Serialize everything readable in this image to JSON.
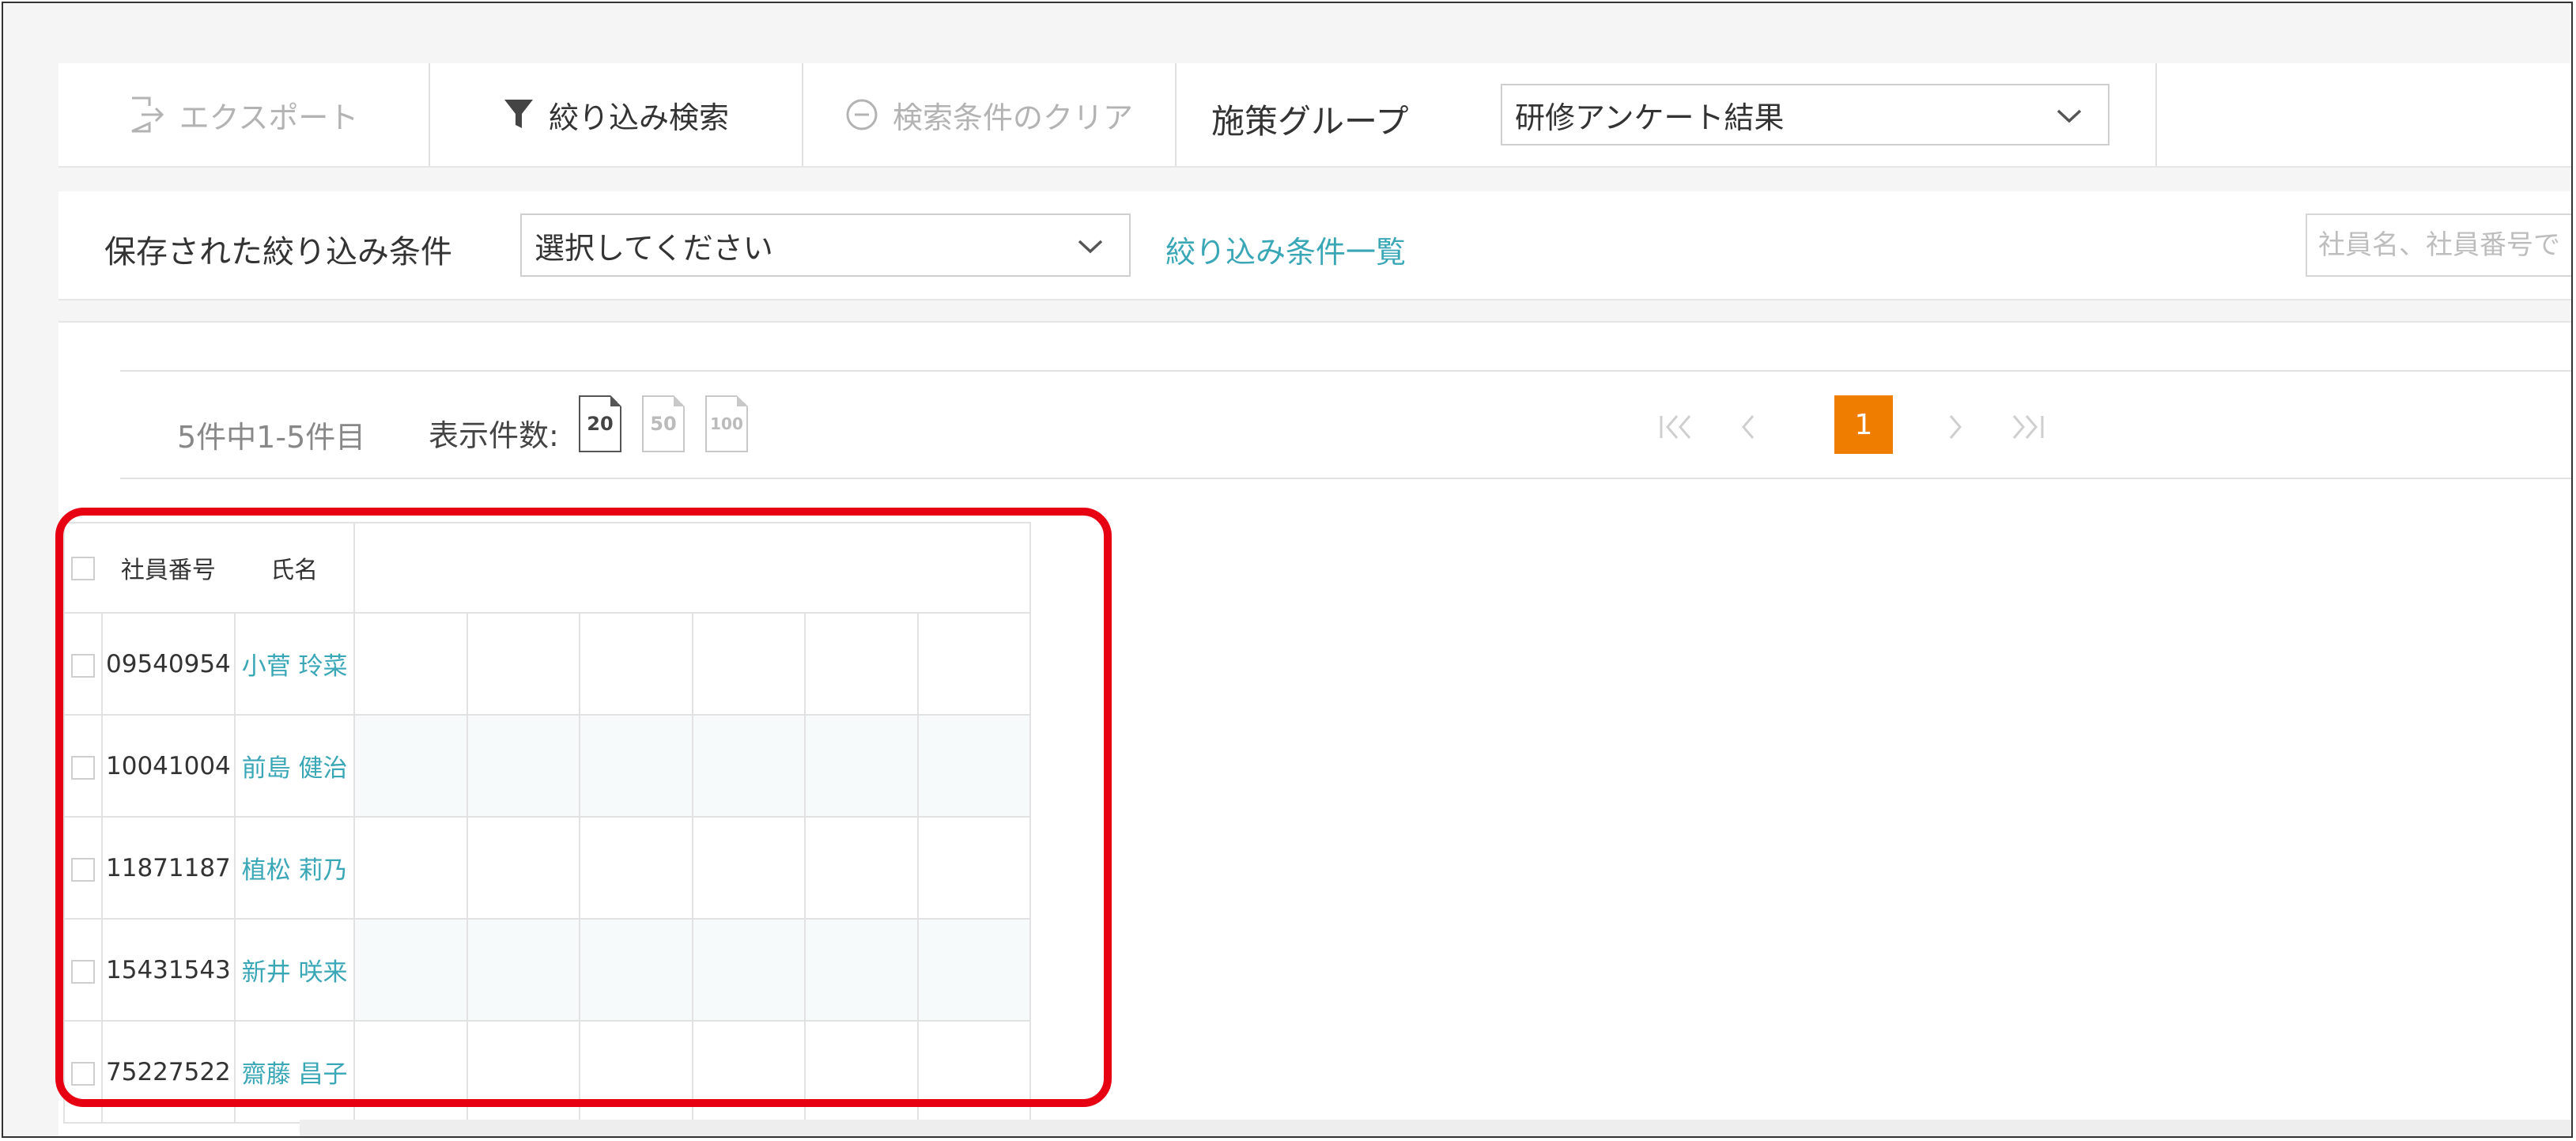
{
  "toolbar": {
    "export_label": "エクスポート",
    "filter_label": "絞り込み検索",
    "clear_label": "検索条件のクリア",
    "group_label": "施策グループ",
    "group_value": "研修アンケート結果"
  },
  "saved_filter": {
    "label": "保存された絞り込み条件",
    "select_value": "選択してください",
    "list_link": "絞り込み条件一覧",
    "search_placeholder": "社員名、社員番号で"
  },
  "pager": {
    "count_text": "5件中1-5件目",
    "per_page_label": "表示件数:",
    "sizes": [
      "20",
      "50",
      "100"
    ],
    "active_size": "20",
    "current_page": "1"
  },
  "table": {
    "headers": {
      "id": "社員番号",
      "name": "氏名"
    },
    "rows": [
      {
        "id": "09540954",
        "name": "小菅 玲菜"
      },
      {
        "id": "10041004",
        "name": "前島 健治"
      },
      {
        "id": "11871187",
        "name": "植松 莉乃"
      },
      {
        "id": "15431543",
        "name": "新井 咲来"
      },
      {
        "id": "75227522",
        "name": "齋藤 昌子"
      }
    ]
  },
  "colors": {
    "accent": "#ef7d00",
    "link": "#3aa7b7",
    "highlight": "#e60012"
  },
  "icons": [
    "export-icon",
    "filter-icon",
    "clear-icon",
    "chevron-down-icon",
    "first-page-icon",
    "prev-page-icon",
    "next-page-icon",
    "last-page-icon"
  ]
}
